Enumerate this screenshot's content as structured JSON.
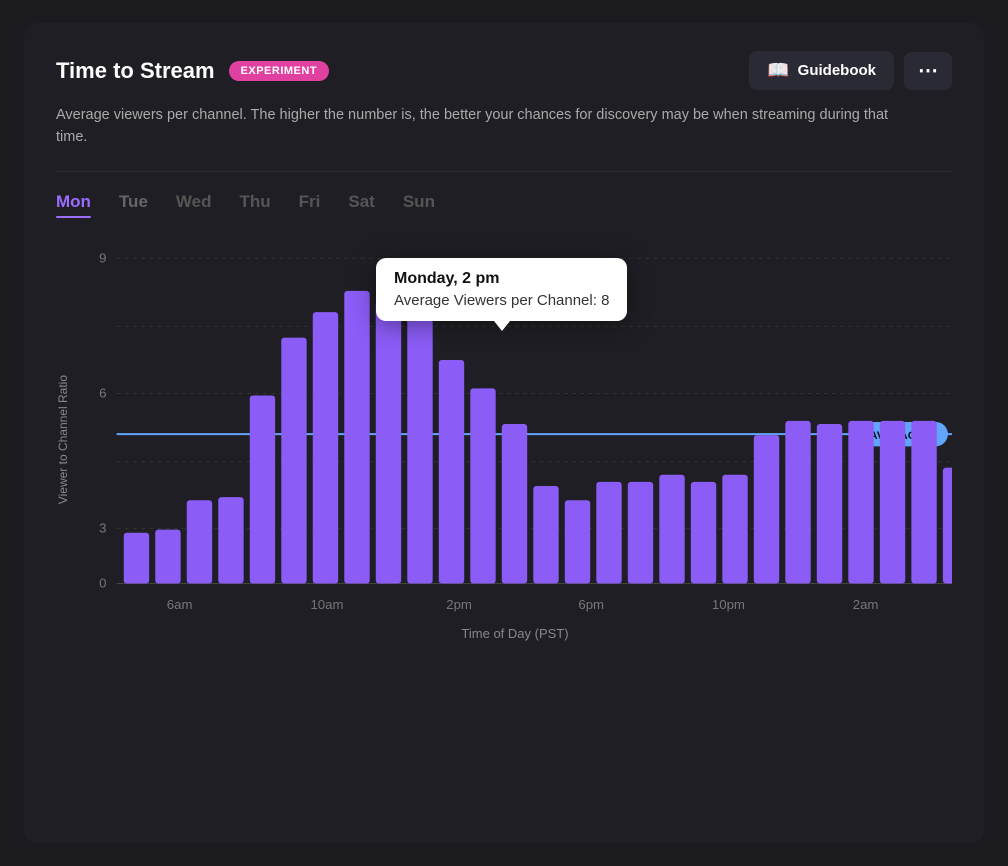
{
  "header": {
    "title": "Time to Stream",
    "badge": "EXPERIMENT",
    "guidebook_label": "Guidebook",
    "more_icon": "⋯"
  },
  "description": "Average viewers per channel. The higher the number is, the better your chances for discovery may be when streaming during that time.",
  "tabs": [
    {
      "label": "Mon",
      "active": true
    },
    {
      "label": "Tue",
      "active": false
    },
    {
      "label": "Wed",
      "active": false
    },
    {
      "label": "Thu",
      "active": false
    },
    {
      "label": "Fri",
      "active": false
    },
    {
      "label": "Sat",
      "active": false
    },
    {
      "label": "Sun",
      "active": false
    }
  ],
  "chart": {
    "y_axis_label": "Viewer to Channel Ratio",
    "x_axis_title": "Time of Day (PST)",
    "y_max": 9,
    "average": 5,
    "average_label": "AVERAGE: 5",
    "x_labels": [
      "6am",
      "10am",
      "2pm",
      "6pm",
      "10pm",
      "2am"
    ],
    "bars": [
      1.4,
      1.5,
      2.3,
      2.4,
      5.2,
      6.8,
      7.5,
      8.1,
      7.8,
      8.1,
      6.2,
      5.4,
      4.4,
      2.7,
      2.3,
      2.8,
      2.8,
      3.0,
      2.8,
      3.0,
      4.1,
      4.5,
      4.4,
      4.5,
      4.5,
      4.5,
      3.2
    ],
    "bar_color": "#8b5cf6",
    "average_line_color": "#60a5fa"
  },
  "tooltip": {
    "title": "Monday, 2 pm",
    "value_label": "Average Viewers per Channel: 8"
  }
}
